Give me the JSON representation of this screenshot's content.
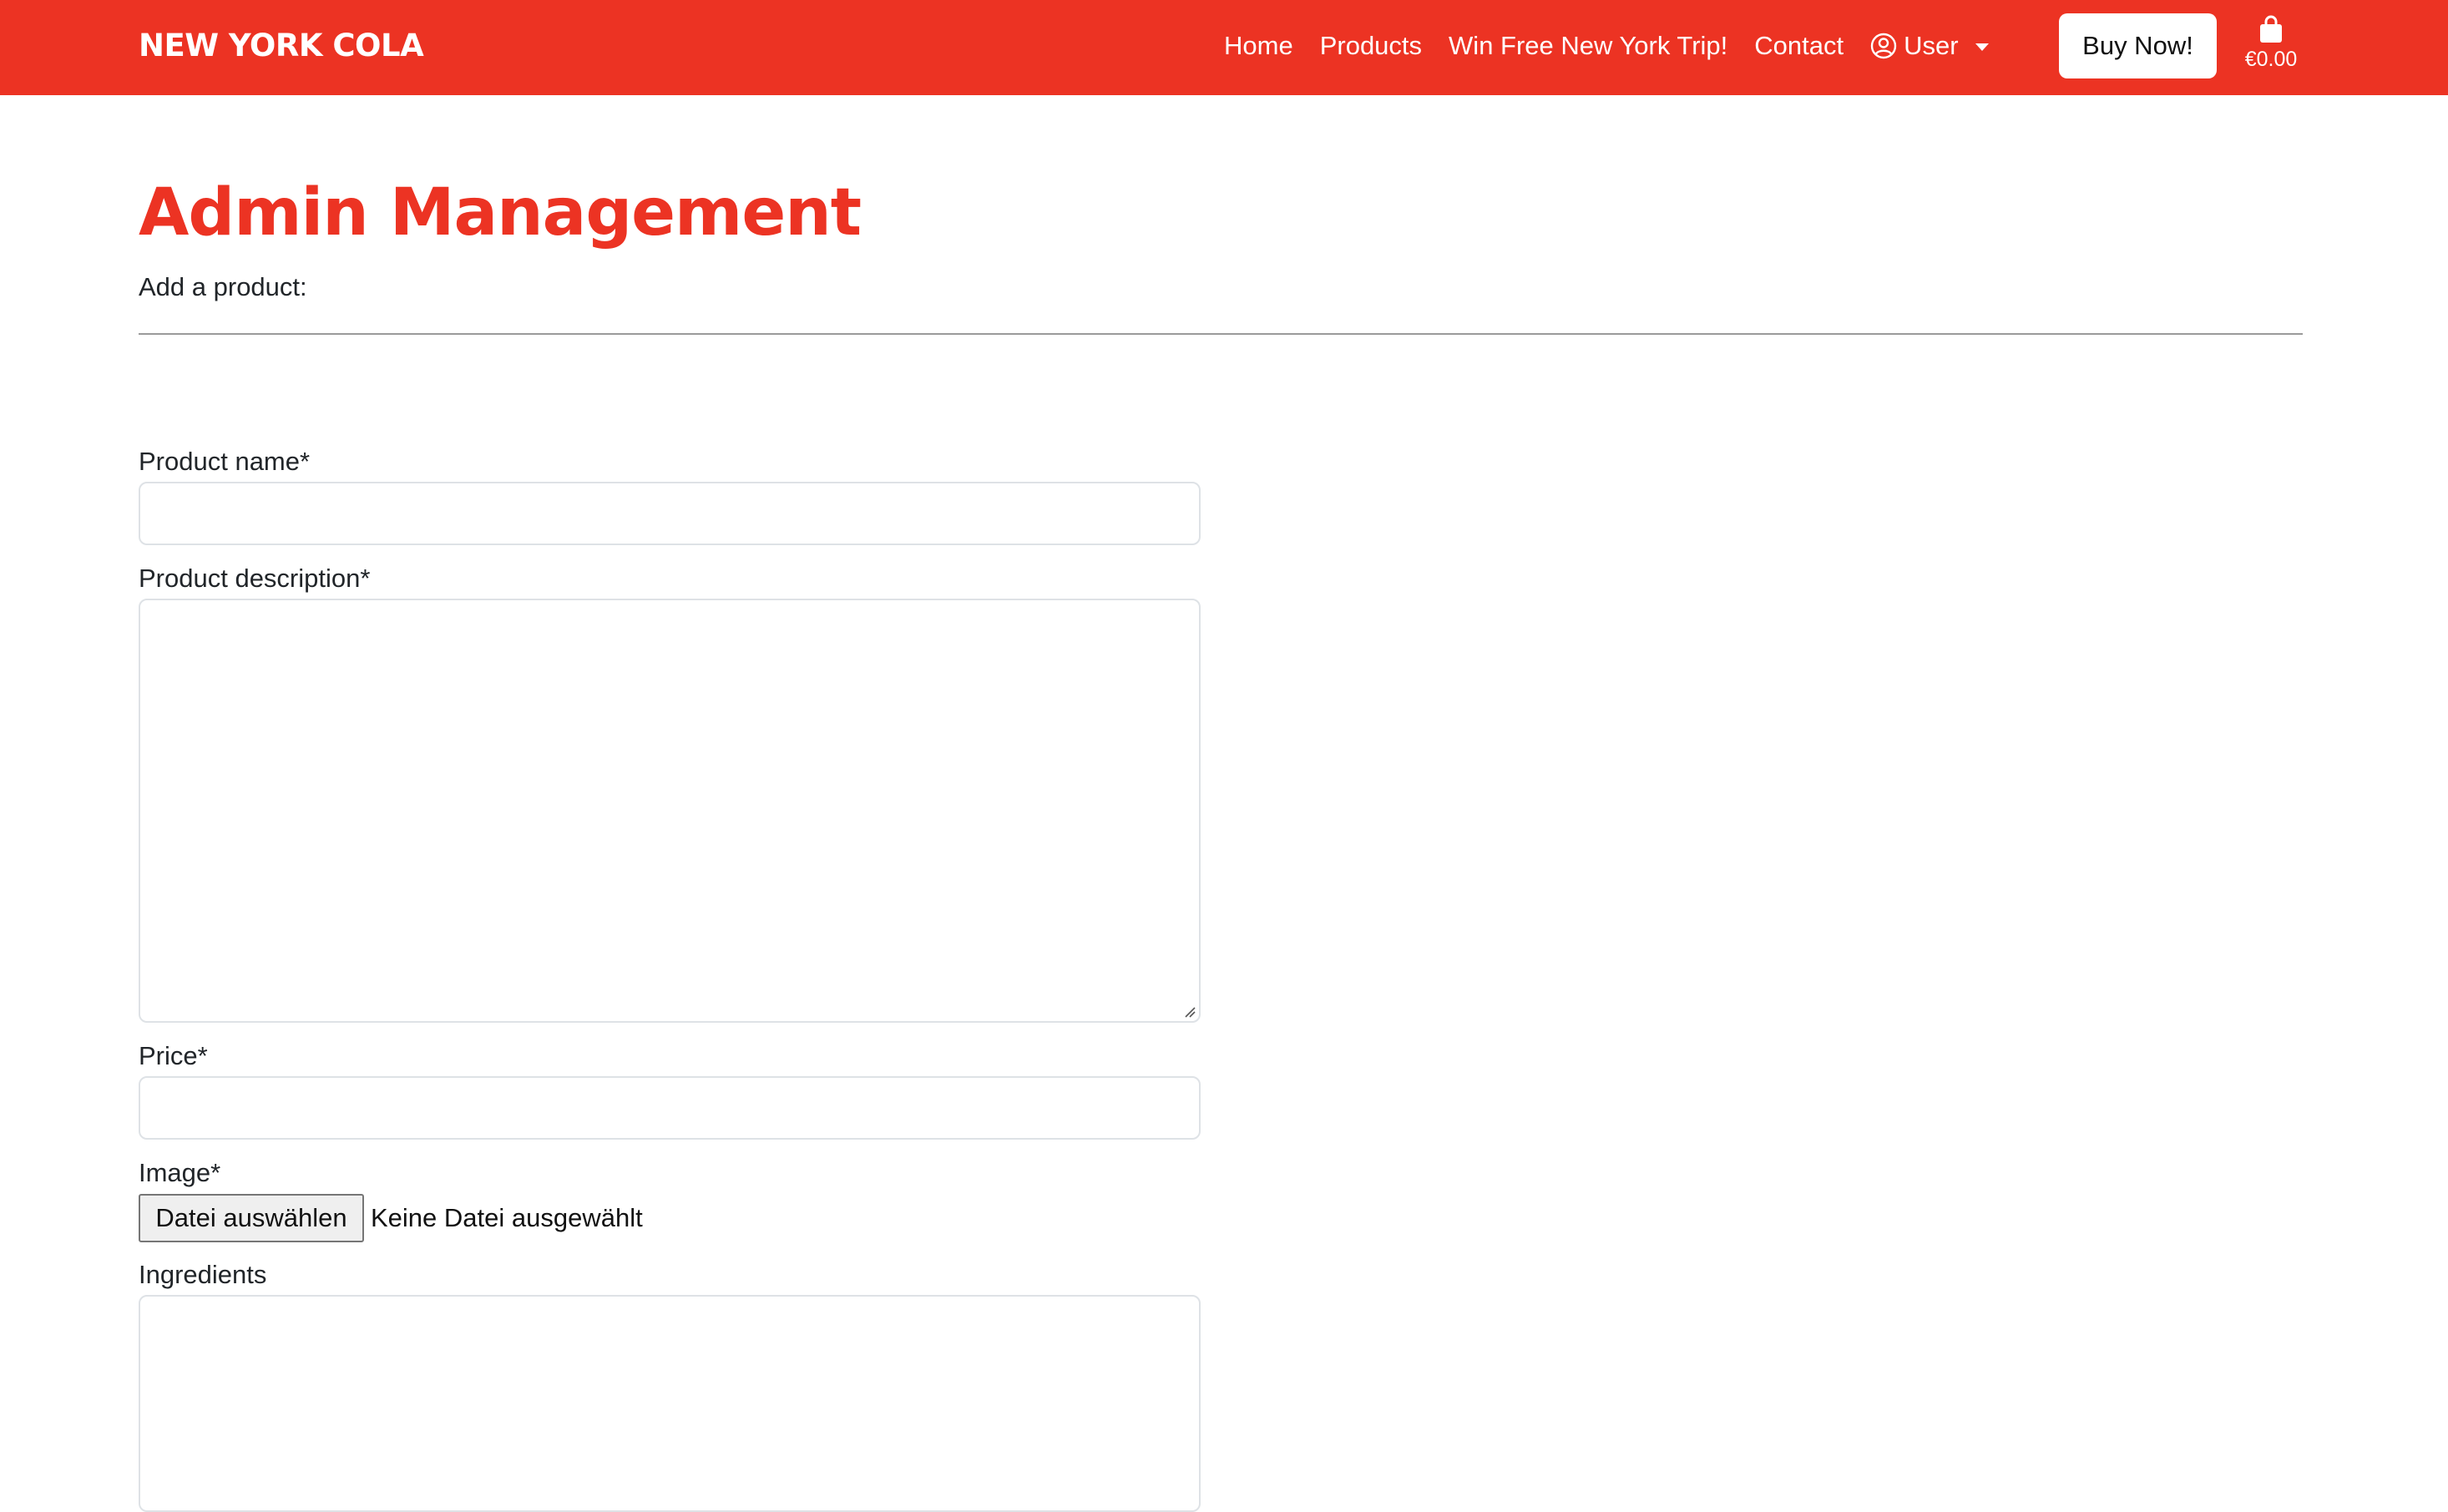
{
  "navbar": {
    "brand": "NEW YORK COLA",
    "links": [
      "Home",
      "Products",
      "Win Free New York Trip!",
      "Contact"
    ],
    "user_label": "User",
    "buy_now_label": "Buy Now!",
    "cart_total": "€0.00",
    "icons": {
      "user": "person-circle-icon",
      "caret": "caret-down-icon",
      "cart": "shopping-bag-icon"
    }
  },
  "page": {
    "title": "Admin Management",
    "subtitle": "Add a product:"
  },
  "form": {
    "product_name": {
      "label": "Product name*",
      "value": ""
    },
    "product_description": {
      "label": "Product description*",
      "value": ""
    },
    "price": {
      "label": "Price*",
      "value": ""
    },
    "image": {
      "label": "Image*",
      "button_label": "Datei auswählen",
      "status": "Keine Datei ausgewählt"
    },
    "ingredients": {
      "label": "Ingredients",
      "value": ""
    }
  },
  "colors": {
    "brand_red": "#ec3323",
    "white": "#ffffff",
    "input_border": "#dee2e6",
    "divider": "#9a9a9a"
  }
}
